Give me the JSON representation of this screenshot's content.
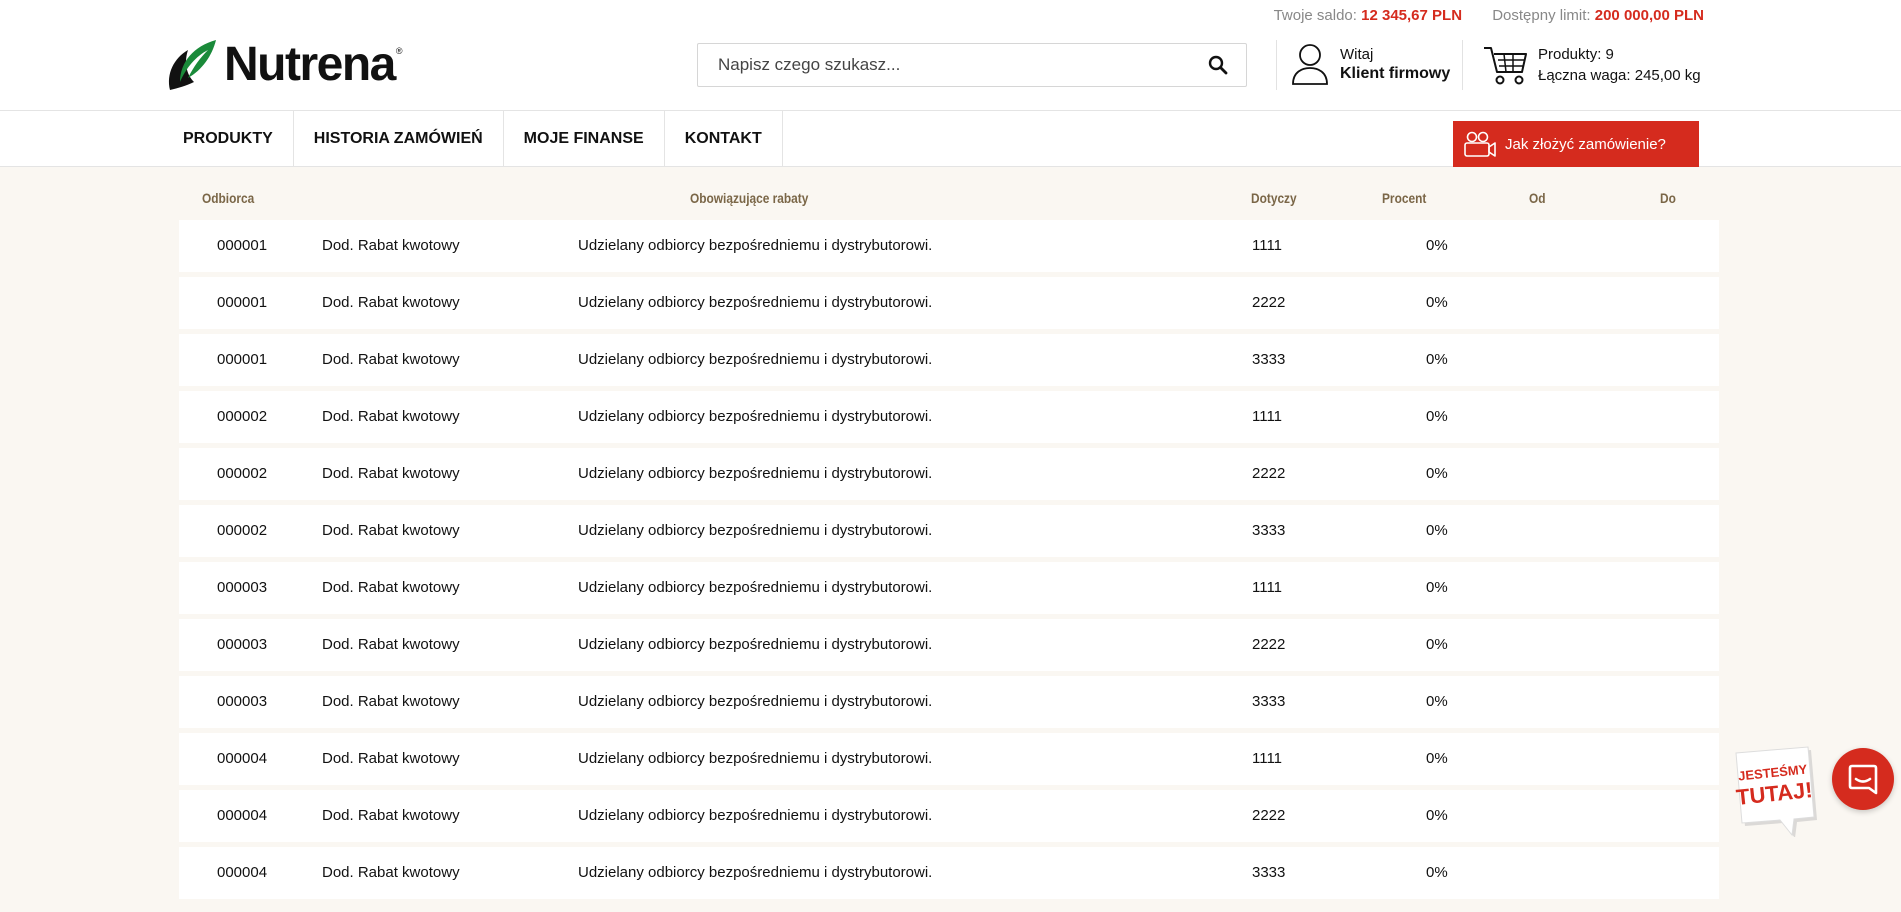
{
  "topbar": {
    "balance_label": "Twoje saldo:",
    "balance_value": "12 345,67 PLN",
    "limit_label": "Dostępny limit:",
    "limit_value": "200 000,00 PLN"
  },
  "logo": {
    "text": "Nutrena",
    "reg": "®"
  },
  "search": {
    "placeholder": "Napisz czego szukasz...",
    "value": ""
  },
  "user": {
    "greeting": "Witaj",
    "name": "Klient firmowy"
  },
  "cart": {
    "products": "Produkty: 9",
    "weight": "Łączna waga: 245,00 kg"
  },
  "nav": {
    "items": [
      "PRODUKTY",
      "HISTORIA ZAMÓWIEŃ",
      "MOJE FINANSE",
      "KONTAKT"
    ],
    "howto_label": "Jak złożyć zamówienie?"
  },
  "table": {
    "headers": {
      "recipient": "Odbiorca",
      "discounts": "Obowiązujące rabaty",
      "applies": "Dotyczy",
      "percent": "Procent",
      "from": "Od",
      "to": "Do"
    },
    "rows": [
      {
        "recipient": "000001",
        "name": "Dod. Rabat kwotowy",
        "desc": "Udzielany odbiorcy bezpośredniemu i dystrybutorowi.",
        "applies": "1111",
        "percent": "0%"
      },
      {
        "recipient": "000001",
        "name": "Dod. Rabat kwotowy",
        "desc": "Udzielany odbiorcy bezpośredniemu i dystrybutorowi.",
        "applies": "2222",
        "percent": "0%"
      },
      {
        "recipient": "000001",
        "name": "Dod. Rabat kwotowy",
        "desc": "Udzielany odbiorcy bezpośredniemu i dystrybutorowi.",
        "applies": "3333",
        "percent": "0%"
      },
      {
        "recipient": "000002",
        "name": "Dod. Rabat kwotowy",
        "desc": "Udzielany odbiorcy bezpośredniemu i dystrybutorowi.",
        "applies": "1111",
        "percent": "0%"
      },
      {
        "recipient": "000002",
        "name": "Dod. Rabat kwotowy",
        "desc": "Udzielany odbiorcy bezpośredniemu i dystrybutorowi.",
        "applies": "2222",
        "percent": "0%"
      },
      {
        "recipient": "000002",
        "name": "Dod. Rabat kwotowy",
        "desc": "Udzielany odbiorcy bezpośredniemu i dystrybutorowi.",
        "applies": "3333",
        "percent": "0%"
      },
      {
        "recipient": "000003",
        "name": "Dod. Rabat kwotowy",
        "desc": "Udzielany odbiorcy bezpośredniemu i dystrybutorowi.",
        "applies": "1111",
        "percent": "0%"
      },
      {
        "recipient": "000003",
        "name": "Dod. Rabat kwotowy",
        "desc": "Udzielany odbiorcy bezpośredniemu i dystrybutorowi.",
        "applies": "2222",
        "percent": "0%"
      },
      {
        "recipient": "000003",
        "name": "Dod. Rabat kwotowy",
        "desc": "Udzielany odbiorcy bezpośredniemu i dystrybutorowi.",
        "applies": "3333",
        "percent": "0%"
      },
      {
        "recipient": "000004",
        "name": "Dod. Rabat kwotowy",
        "desc": "Udzielany odbiorcy bezpośredniemu i dystrybutorowi.",
        "applies": "1111",
        "percent": "0%"
      },
      {
        "recipient": "000004",
        "name": "Dod. Rabat kwotowy",
        "desc": "Udzielany odbiorcy bezpośredniemu i dystrybutorowi.",
        "applies": "2222",
        "percent": "0%"
      },
      {
        "recipient": "000004",
        "name": "Dod. Rabat kwotowy",
        "desc": "Udzielany odbiorcy bezpośredniemu i dystrybutorowi.",
        "applies": "3333",
        "percent": "0%"
      }
    ]
  },
  "badge": {
    "line1": "JESTEŚMY",
    "line2": "TUTAJ!"
  },
  "icons": {
    "search": "search-icon",
    "user": "user-icon",
    "cart": "cart-icon",
    "video": "video-call-icon",
    "chat": "chat-icon",
    "logo_leaf": "leaf-logo-icon"
  },
  "colors": {
    "accent": "#d52b1e",
    "header_text": "#7a6647",
    "page_bg": "#faf7f2"
  }
}
